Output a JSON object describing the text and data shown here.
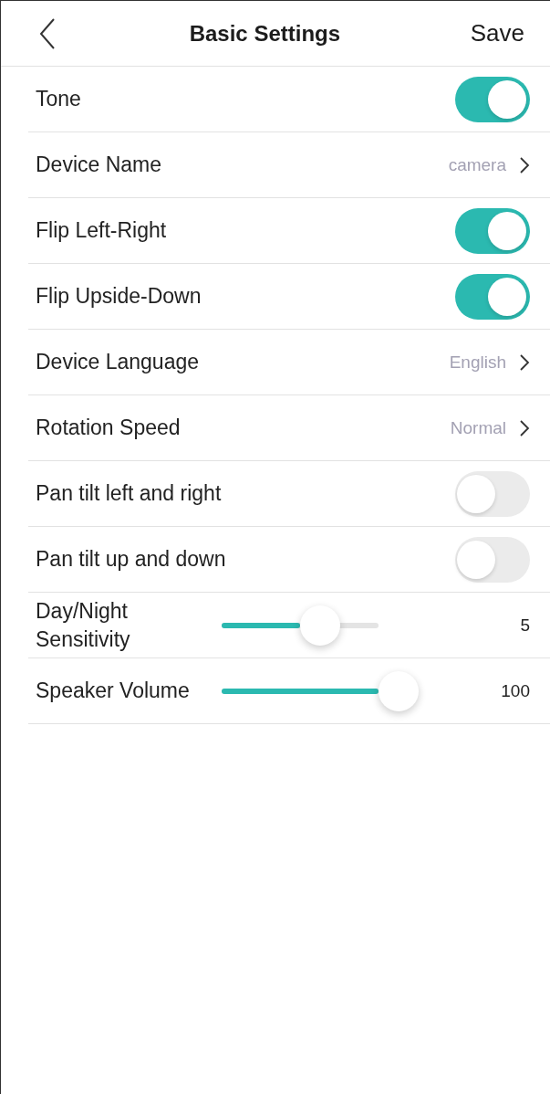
{
  "header": {
    "title": "Basic Settings",
    "action": "Save"
  },
  "settings": [
    {
      "kind": "toggle",
      "label": "Tone",
      "on": true
    },
    {
      "kind": "link",
      "label": "Device Name",
      "value": "camera"
    },
    {
      "kind": "toggle",
      "label": "Flip Left-Right",
      "on": true
    },
    {
      "kind": "toggle",
      "label": "Flip Upside-Down",
      "on": true
    },
    {
      "kind": "link",
      "label": "Device Language",
      "value": "English"
    },
    {
      "kind": "link",
      "label": "Rotation Speed",
      "value": "Normal"
    },
    {
      "kind": "toggle",
      "label": "Pan tilt left and right",
      "on": false
    },
    {
      "kind": "toggle",
      "label": "Pan tilt up and down",
      "on": false
    },
    {
      "kind": "slider",
      "label": "Day/Night Sensitivity",
      "level": 0.5,
      "reading": "5"
    },
    {
      "kind": "slider",
      "label": "Speaker Volume",
      "level": 1,
      "reading": "100"
    }
  ]
}
